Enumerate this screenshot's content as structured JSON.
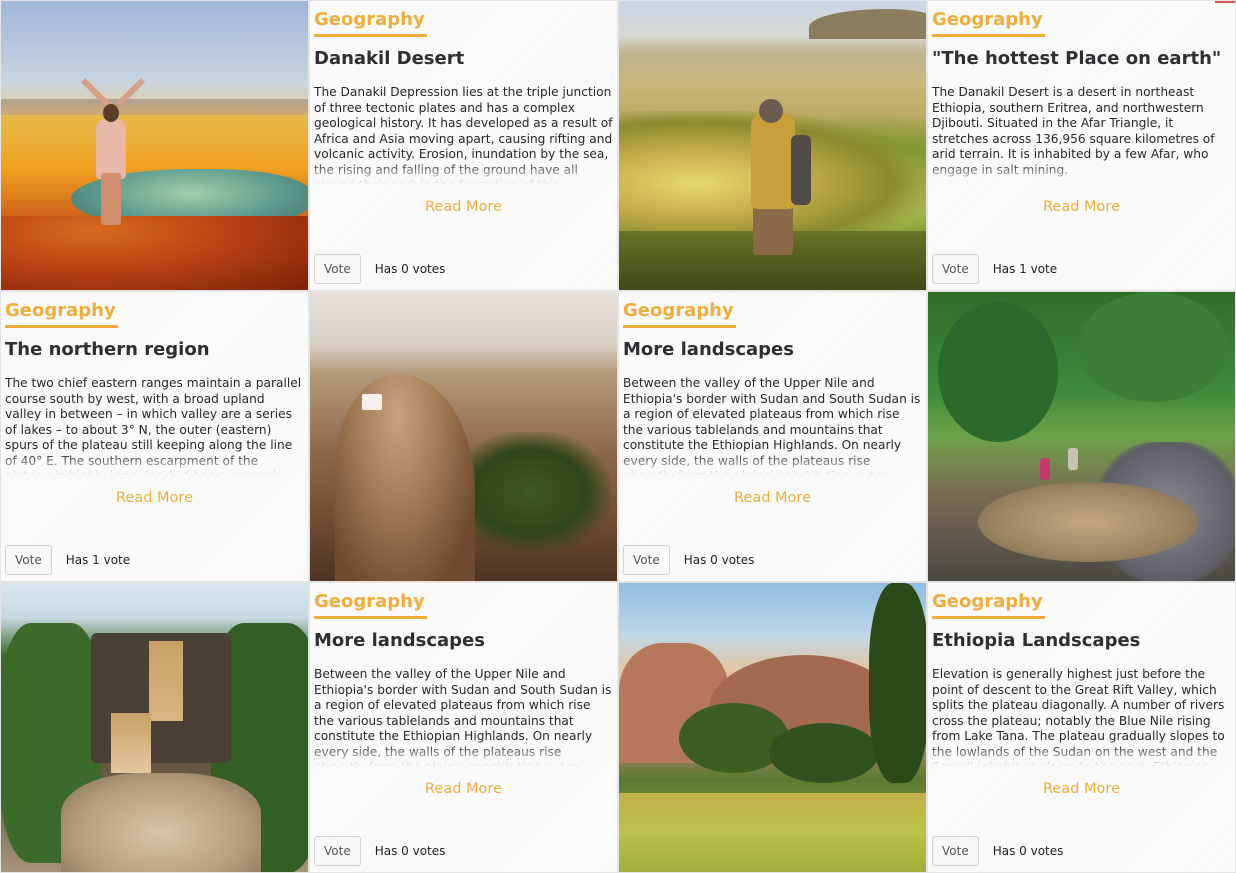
{
  "tiles": {
    "r1c2": {
      "category": "Geography",
      "title": "Danakil Desert",
      "description": "The Danakil Depression lies at the triple junction of three tectonic plates and has a complex geological history. It has developed as a result of Africa and Asia moving apart, causing rifting and volcanic activity. Erosion, inundation by the sea, the rising and falling of the ground have all played their part in the formation of this depression. Sedimentary",
      "read_more": "Read More",
      "vote_label": "Vote",
      "votes_text": "Has 0 votes"
    },
    "r1c4": {
      "category": "Geography",
      "title": "\"The hottest Place on earth\"",
      "description": "The Danakil Desert is a desert in northeast Ethiopia, southern Eritrea, and northwestern Djibouti. Situated in the Afar Triangle, it stretches across 136,956 square kilometres of arid terrain. It is inhabited by a few Afar, who engage in salt mining.",
      "read_more": "Read More",
      "vote_label": "Vote",
      "votes_text": "Has 1 vote"
    },
    "r2c1": {
      "category": "Geography",
      "title": "The northern region",
      "description": "The two chief eastern ranges maintain a parallel course south by west, with a broad upland valley in between – in which valley are a series of lakes – to about 3° N, the outer (eastern) spurs of the plateau still keeping along the line of 40° E. The southern escarpment of the plateau is highly irregular, but has a general direction northwest and southeast",
      "read_more": "Read More",
      "vote_label": "Vote",
      "votes_text": "Has 1 vote"
    },
    "r2c3": {
      "category": "Geography",
      "title": "More landscapes",
      "description": "Between the valley of the Upper Nile and Ethiopia's border with Sudan and South Sudan is a region of elevated plateaus from which rise the various tablelands and mountains that constitute the Ethiopian Highlands. On nearly every side, the walls of the plateaus rise abruptly from the plains, constituting outer mountain chains. The highlands",
      "read_more": "Read More",
      "vote_label": "Vote",
      "votes_text": "Has 0 votes"
    },
    "r3c2": {
      "category": "Geography",
      "title": "More landscapes",
      "description": "Between the valley of the Upper Nile and Ethiopia's border with Sudan and South Sudan is a region of elevated plateaus from which rise the various tablelands and mountains that constitute the Ethiopian Highlands. On nearly every side, the walls of the plateaus rise abruptly from the plains, constituting outer mountain chains. The highlands",
      "read_more": "Read More",
      "vote_label": "Vote",
      "votes_text": "Has 0 votes"
    },
    "r3c4": {
      "category": "Geography",
      "title": "Ethiopia Landscapes",
      "description": "Elevation is generally highest just before the point of descent to the Great Rift Valley, which splits the plateau diagonally. A number of rivers cross the plateau; notably the Blue Nile rising from Lake Tana. The plateau gradually slopes to the lowlands of the Sudan on the west and the Somali-inhabited plains to the east. Ethiopia's westernmost locality is",
      "read_more": "Read More",
      "vote_label": "Vote",
      "votes_text": "Has 0 votes"
    }
  },
  "colors": {
    "accent": "#f0ad3c",
    "title": "#2d2f32",
    "card_bg": "#fbfbfb"
  }
}
